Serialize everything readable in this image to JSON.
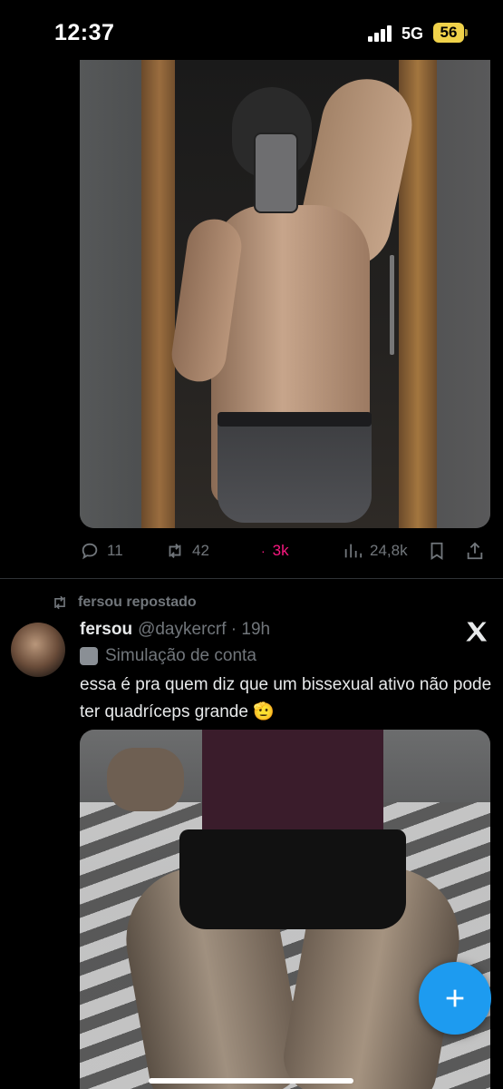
{
  "status_bar": {
    "time": "12:37",
    "network": "5G",
    "battery": "56"
  },
  "first_tweet": {
    "actions": {
      "replies": "11",
      "reposts": "42",
      "likes": "3k",
      "views": "24,8k"
    }
  },
  "second_tweet": {
    "repost_label": "fersou repostado",
    "name": "fersou",
    "handle_time": "@daykercrf · 19h",
    "account_label": "Simulação de conta",
    "text": "essa é pra quem diz que um bissexual ativo não pode ter quadríceps grande 🫡"
  },
  "colors": {
    "accent": "#1d9bf0",
    "like": "#f91880",
    "muted": "#71767b",
    "battery": "#f0d24a"
  },
  "icons": [
    "reply-icon",
    "repost-icon",
    "like-icon",
    "views-icon",
    "bookmark-icon",
    "share-icon",
    "x-logo-icon",
    "mask-icon",
    "compose-plus-icon"
  ]
}
